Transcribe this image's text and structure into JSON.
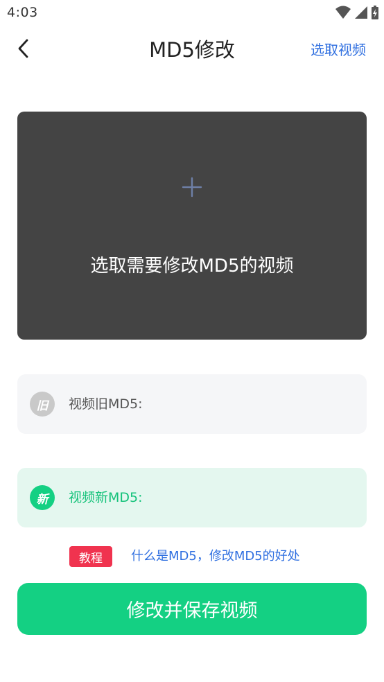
{
  "status_bar": {
    "time": "4:03",
    "icons": [
      "wifi-icon",
      "signal-icon",
      "battery-charging-icon"
    ]
  },
  "header": {
    "back_icon": "chevron-left-icon",
    "title": "MD5修改",
    "action_label": "选取视频"
  },
  "picker": {
    "icon": "plus-icon",
    "label": "选取需要修改MD5的视频"
  },
  "md5": {
    "old": {
      "badge": "旧",
      "label": "视频旧MD5:"
    },
    "new": {
      "badge": "新",
      "label": "视频新MD5:"
    }
  },
  "tutorial": {
    "badge": "教程",
    "link": "什么是MD5，修改MD5的好处"
  },
  "save_button": {
    "label": "修改并保存视频"
  },
  "colors": {
    "accent_green": "#14d083",
    "link_blue": "#2f6fe0",
    "badge_red": "#f0334f",
    "picker_bg": "#444444"
  }
}
